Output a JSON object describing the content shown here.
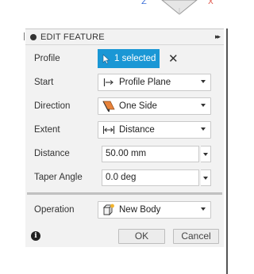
{
  "viewcube": {
    "axis_z": "Z",
    "axis_x": "X"
  },
  "panel": {
    "title": "EDIT FEATURE",
    "expand_glyph": "▸▸"
  },
  "rows": {
    "profile": {
      "label": "Profile",
      "value": "1 selected",
      "clear": "✕"
    },
    "start": {
      "label": "Start",
      "value": "Profile Plane",
      "icon": "profile-plane-icon"
    },
    "direction": {
      "label": "Direction",
      "value": "One Side",
      "icon": "one-side-icon"
    },
    "extent": {
      "label": "Extent",
      "value": "Distance",
      "icon": "distance-icon"
    },
    "distance": {
      "label": "Distance",
      "value": "50.00 mm"
    },
    "taper": {
      "label": "Taper Angle",
      "value": "0.0 deg"
    },
    "operation": {
      "label": "Operation",
      "value": "New Body",
      "icon": "new-body-icon"
    }
  },
  "footer": {
    "ok": "OK",
    "cancel": "Cancel",
    "info": "i"
  },
  "colors": {
    "accent": "#1a97d5",
    "panel_bg": "#f2f2f2",
    "direction_icon": "#e8833a"
  }
}
